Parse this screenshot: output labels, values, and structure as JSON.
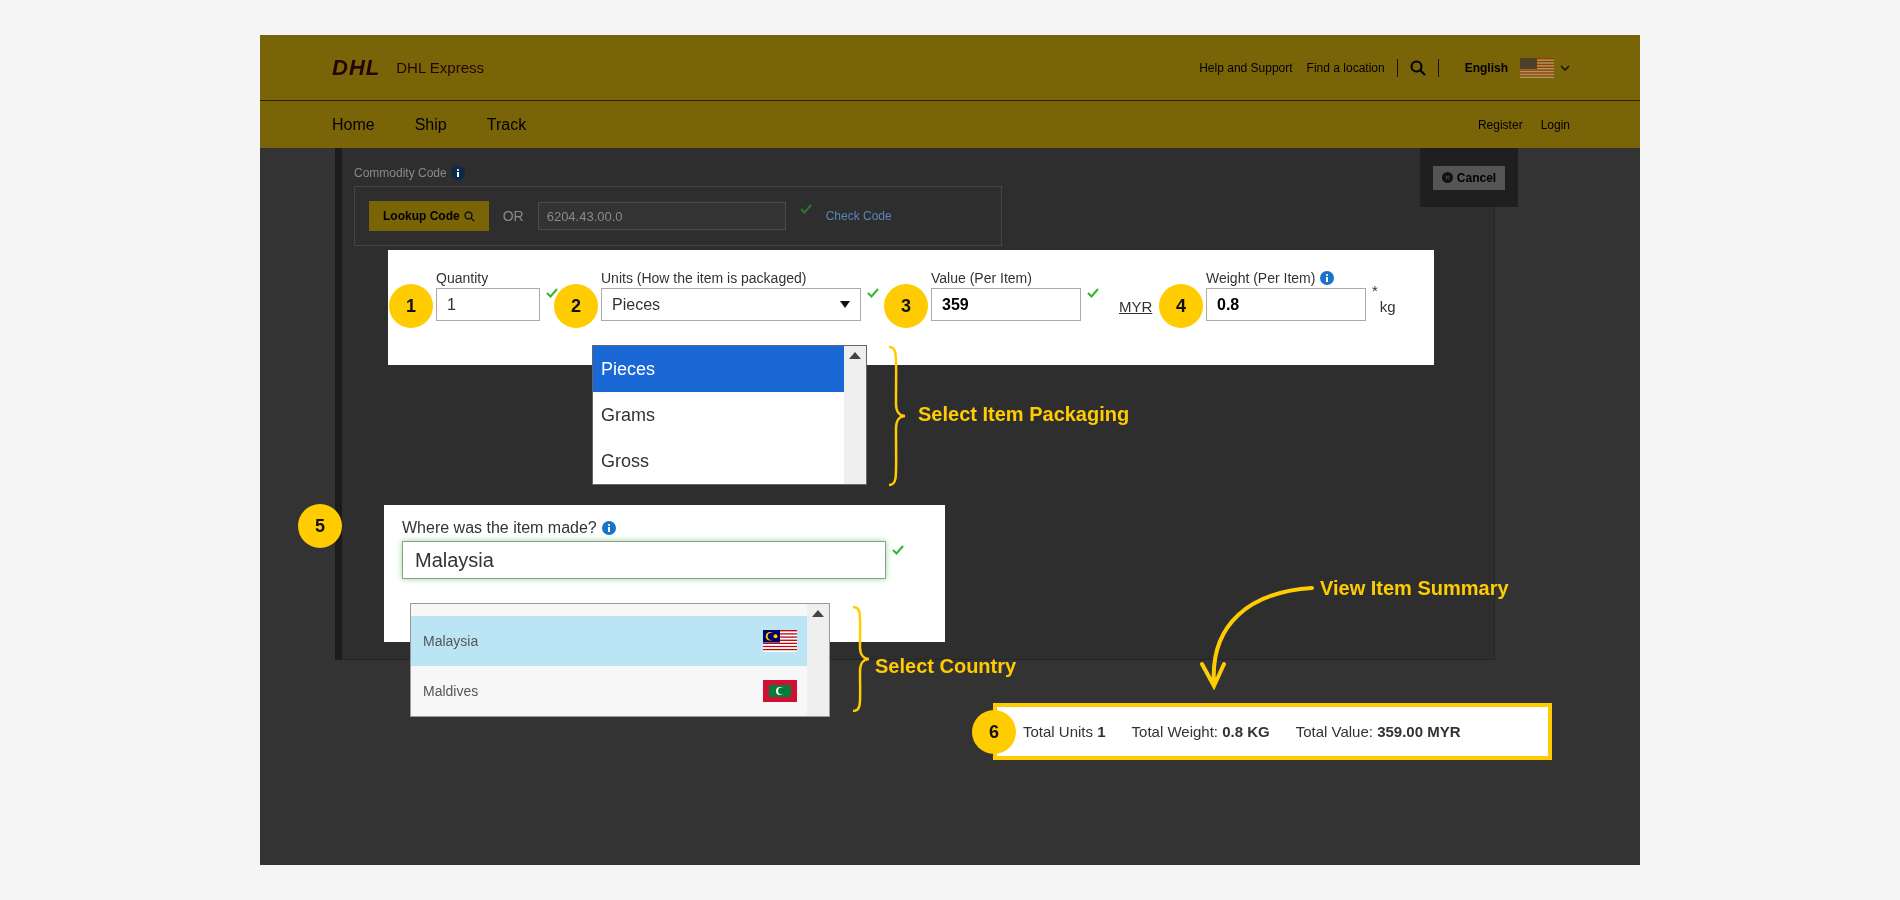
{
  "header": {
    "logo": "DHL",
    "brand": "DHL Express",
    "links": [
      "Help and Support",
      "Find a location"
    ],
    "language": "English",
    "nav": [
      "Home",
      "Ship",
      "Track"
    ],
    "account_links": [
      "Register",
      "Login"
    ]
  },
  "commodity": {
    "label": "Commodity Code",
    "lookup_button": "Lookup Code",
    "separator": "OR",
    "code": "6204.43.00.0",
    "valid": true,
    "check_link": "Check Code"
  },
  "cancel_button": "Cancel",
  "item_fields": [
    {
      "kind": "text",
      "step": "1",
      "label": "Quantity",
      "info": false,
      "value": "1",
      "valid": true,
      "bold": false
    },
    {
      "kind": "select",
      "step": "2",
      "label": "Units (How the item is packaged)",
      "info": false,
      "value": "Pieces",
      "valid": true,
      "bold": false
    },
    {
      "kind": "text",
      "step": "3",
      "label": "Value (Per Item)",
      "info": false,
      "value": "359",
      "valid": true,
      "bold": true,
      "suffix": "MYR"
    },
    {
      "kind": "text",
      "step": "4",
      "label": "Weight (Per Item)",
      "info": true,
      "value": "0.8",
      "valid": false,
      "bold": true,
      "required_mark": "*",
      "suffix": "kg"
    }
  ],
  "unit_options": [
    {
      "label": "Pieces",
      "selected": true
    },
    {
      "label": "Grams",
      "selected": false
    },
    {
      "label": "Gross",
      "selected": false
    }
  ],
  "origin": {
    "step": "5",
    "label": "Where was the item made?",
    "value": "Malaysia",
    "valid": true,
    "options": [
      {
        "label": "Malaysia",
        "kind": "malaysia",
        "selected": true
      },
      {
        "label": "Maldives",
        "kind": "maldives",
        "selected": false
      }
    ]
  },
  "annotations": [
    "Select Item Packaging",
    "Select Country",
    "View Item Summary"
  ],
  "summary": {
    "step": "6",
    "items": [
      {
        "label": "Total Units",
        "value": "1"
      },
      {
        "label": "Total Weight:",
        "value": "0.8 KG"
      },
      {
        "label": "Total Value:",
        "value": "359.00 MYR"
      }
    ]
  }
}
